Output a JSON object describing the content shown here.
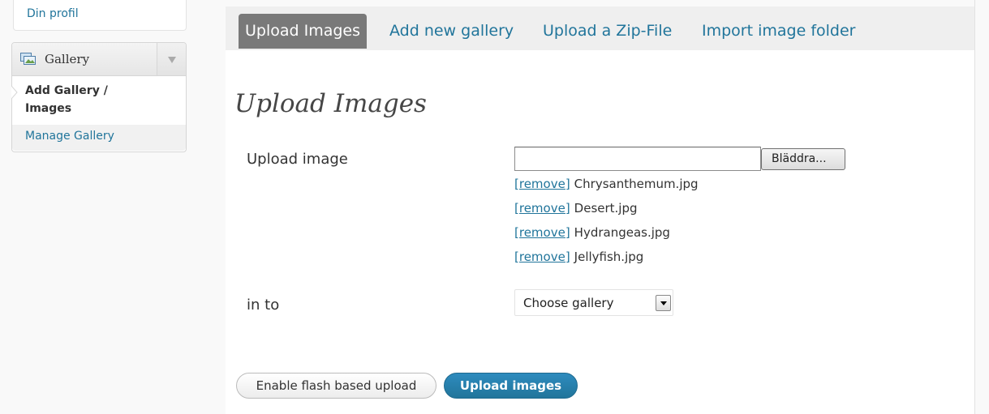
{
  "sidebar": {
    "profile_link": "Din profil",
    "menu": {
      "title": "Gallery",
      "items": [
        {
          "label_line1": "Add Gallery /",
          "label_line2": "Images",
          "active": true
        },
        {
          "label": "Manage Gallery",
          "active": false
        }
      ]
    }
  },
  "tabs": [
    {
      "label": "Upload Images",
      "active": true
    },
    {
      "label": "Add new gallery",
      "active": false
    },
    {
      "label": "Upload a Zip-File",
      "active": false
    },
    {
      "label": "Import image folder",
      "active": false
    }
  ],
  "page": {
    "title": "Upload Images",
    "upload_label": "Upload image",
    "browse_button": "Bläddra...",
    "remove_link": "[remove]",
    "files": [
      "Chrysanthemum.jpg",
      "Desert.jpg",
      "Hydrangeas.jpg",
      "Jellyfish.jpg"
    ],
    "into_label": "in to",
    "gallery_select": {
      "selected": "Choose gallery"
    },
    "flash_button": "Enable flash based upload",
    "upload_button": "Upload images"
  },
  "colors": {
    "link": "#21759b",
    "active_tab_bg": "#797979",
    "primary_button": "#21759b"
  }
}
